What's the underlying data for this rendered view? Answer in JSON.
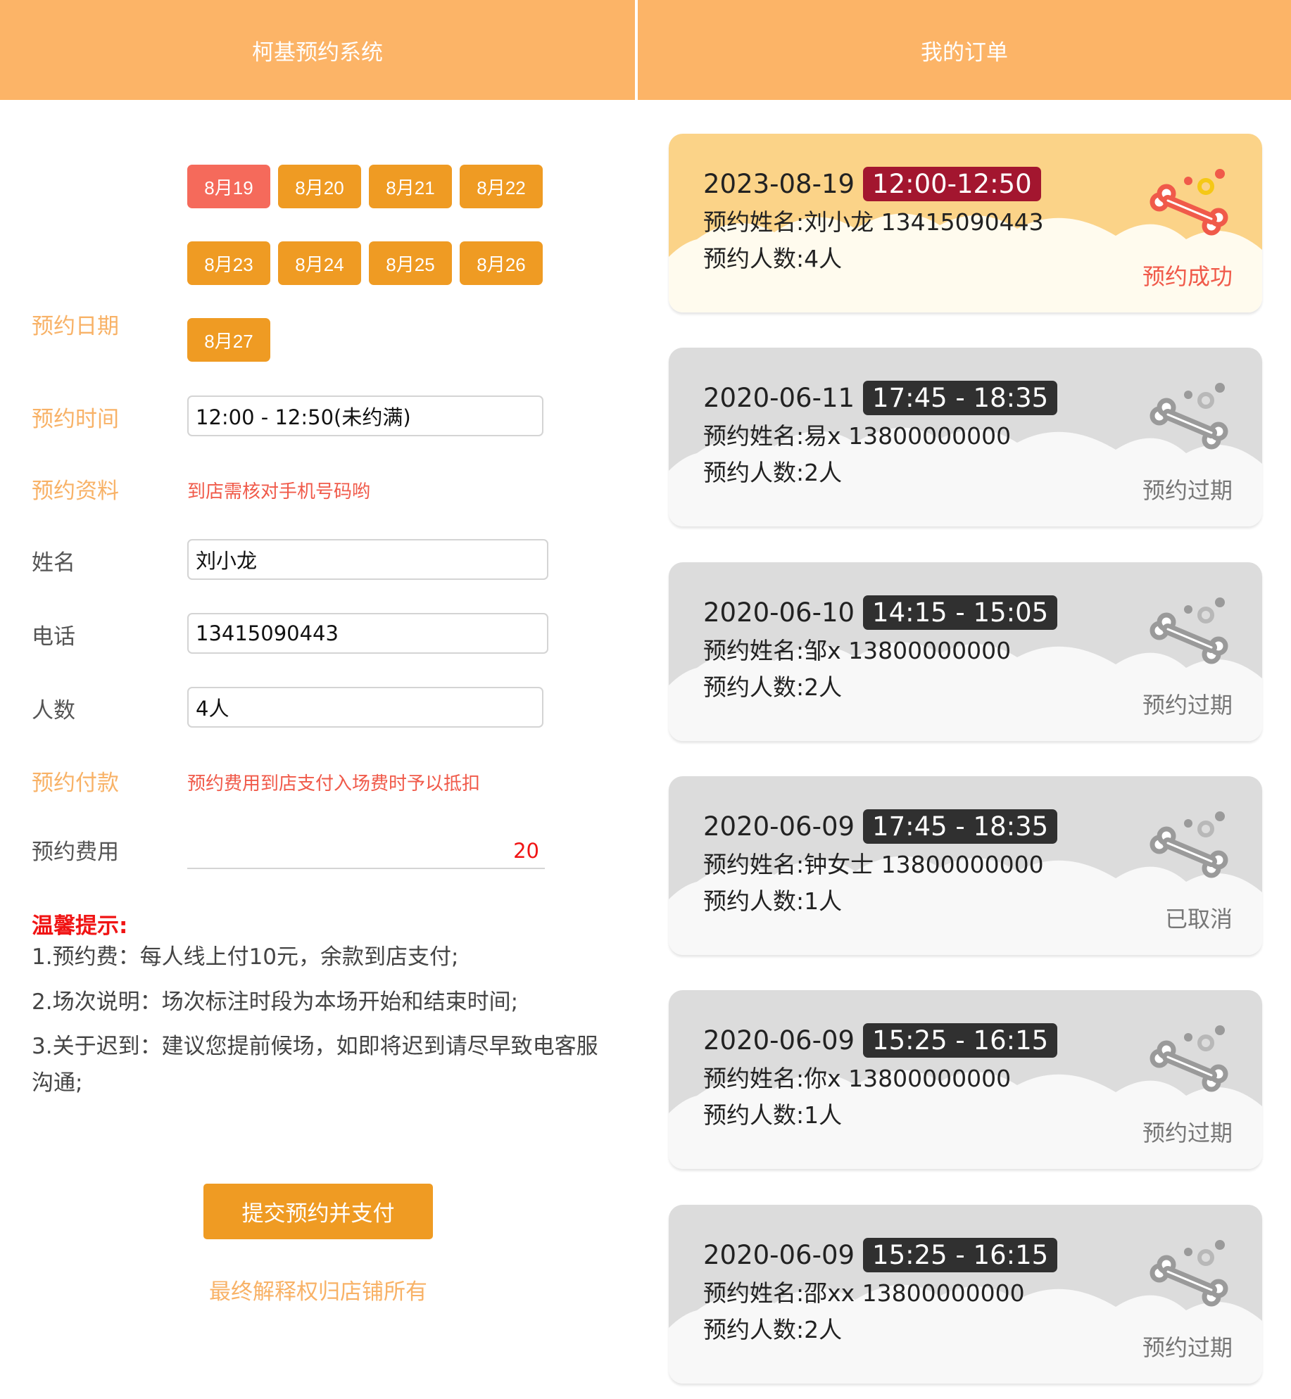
{
  "left": {
    "title": "柯基预约系统",
    "dates": [
      "8月19",
      "8月20",
      "8月21",
      "8月22",
      "8月23",
      "8月24",
      "8月25",
      "8月26",
      "8月27"
    ],
    "selected_date": "8月19",
    "labels": {
      "date": "预约日期",
      "time": "预约时间",
      "info": "预约资料",
      "name": "姓名",
      "phone": "电话",
      "people": "人数",
      "payment": "预约付款",
      "fee": "预约费用"
    },
    "time_value": "12:00 - 12:50(未约满)",
    "info_note": "到店需核对手机号码哟",
    "name_value": "刘小龙",
    "phone_value": "13415090443",
    "people_value": "4人",
    "payment_note": "预约费用到店支付入场费时予以抵扣",
    "fee_value": "20",
    "tips_title": "温馨提示:",
    "tips": [
      "1.预约费：每人线上付10元，余款到店支付;",
      "2.场次说明：场次标注时段为本场开始和结束时间;",
      "3.关于迟到：建议您提前候场，如即将迟到请尽早致电客服沟通;"
    ],
    "submit_label": "提交预约并支付",
    "footer_note": "最终解释权归店铺所有"
  },
  "right": {
    "title": "我的订单",
    "colors": {
      "active_card": "#fbd388",
      "active_time": "#a3162f",
      "expired_card": "#dcdcdc",
      "expired_time": "#303030",
      "status_success": "#f05a4a",
      "status_other": "#777777"
    },
    "orders": [
      {
        "date": "2023-08-19",
        "time": "12:00-12:50",
        "name_line": "预约姓名:刘小龙 13415090443",
        "people_line": "预约人数:4人",
        "status": "预约成功",
        "active": true
      },
      {
        "date": "2020-06-11",
        "time": "17:45 - 18:35",
        "name_line": "预约姓名:易x 13800000000",
        "people_line": "预约人数:2人",
        "status": "预约过期",
        "active": false
      },
      {
        "date": "2020-06-10",
        "time": "14:15 - 15:05",
        "name_line": "预约姓名:邹x 13800000000",
        "people_line": "预约人数:2人",
        "status": "预约过期",
        "active": false
      },
      {
        "date": "2020-06-09",
        "time": "17:45 - 18:35",
        "name_line": "预约姓名:钟女士 13800000000",
        "people_line": "预约人数:1人",
        "status": "已取消",
        "active": false
      },
      {
        "date": "2020-06-09",
        "time": "15:25 - 16:15",
        "name_line": "预约姓名:你x 13800000000",
        "people_line": "预约人数:1人",
        "status": "预约过期",
        "active": false
      },
      {
        "date": "2020-06-09",
        "time": "15:25 - 16:15",
        "name_line": "预约姓名:邵xx 13800000000",
        "people_line": "预约人数:2人",
        "status": "预约过期",
        "active": false
      }
    ]
  }
}
